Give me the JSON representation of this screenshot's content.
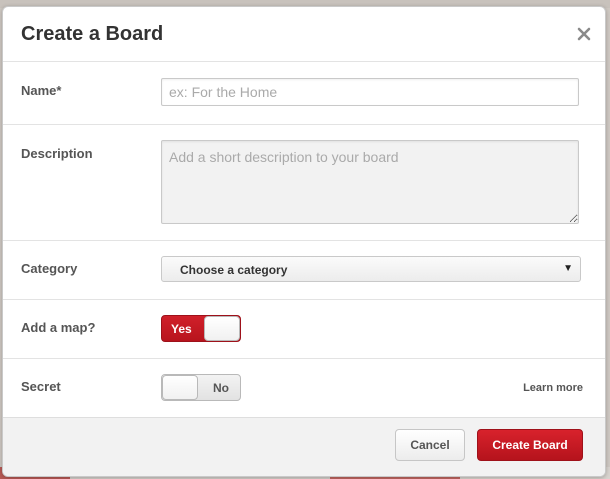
{
  "dialog": {
    "title": "Create a Board",
    "close_icon": "close-icon"
  },
  "fields": {
    "name": {
      "label": "Name*",
      "value": "",
      "placeholder": "ex: For the Home"
    },
    "description": {
      "label": "Description",
      "value": "",
      "placeholder": "Add a short description to your board"
    },
    "category": {
      "label": "Category",
      "selected": "Choose a category",
      "arrow": "▼"
    },
    "map": {
      "label": "Add a map?",
      "state_label": "Yes",
      "checked": true
    },
    "secret": {
      "label": "Secret",
      "state_label": "No",
      "checked": false,
      "learn_more": "Learn more"
    }
  },
  "footer": {
    "cancel_label": "Cancel",
    "create_label": "Create Board"
  },
  "colors": {
    "accent": "#c8141f",
    "text": "#333333",
    "label": "#555555"
  }
}
